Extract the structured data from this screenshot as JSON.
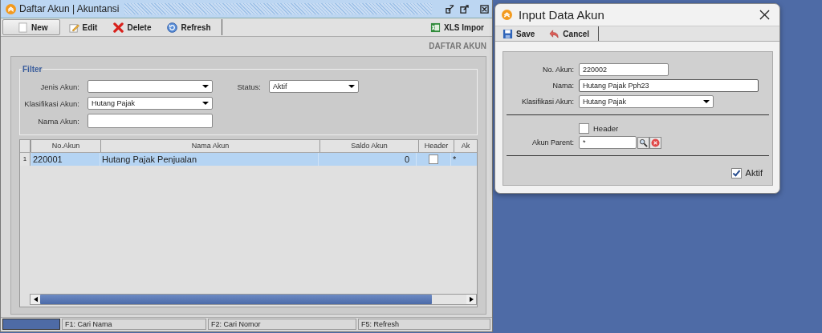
{
  "window": {
    "title": "Daftar Akun | Akuntansi"
  },
  "toolbar": [
    {
      "label": "New",
      "kind": "new"
    },
    {
      "label": "Edit",
      "kind": "edit"
    },
    {
      "label": "Delete",
      "kind": "delete"
    },
    {
      "label": "Refresh",
      "kind": "refresh"
    }
  ],
  "xls_button": {
    "label": "XLS Impor"
  },
  "page_heading": "DAFTAR AKUN",
  "filter": {
    "title": "Filter",
    "jenis_akun": {
      "label": "Jenis Akun:"
    },
    "status": {
      "label": "Status:",
      "value": "Aktif"
    },
    "klasifikasi_akun": {
      "label": "Klasifikasi Akun:",
      "value": "Hutang Pajak"
    },
    "nama_akun": {
      "label": "Nama Akun:"
    }
  },
  "table": {
    "columns": [
      "No.Akun",
      "Nama Akun",
      "Saldo Akun",
      "Header",
      "Ak"
    ],
    "rows": [
      {
        "number": "1",
        "no_akun": "220001",
        "nama_akun": "Hutang Pajak Penjualan",
        "saldo_akun": "0",
        "header": false,
        "column_5": "*",
        "selected": true
      }
    ]
  },
  "status_bar": [
    "F1: Cari Nama",
    "F2: Cari Nomor",
    "F5: Refresh"
  ],
  "dialog": {
    "title": "Input Data Akun",
    "toolbar": [
      {
        "label": "Save",
        "kind": "save"
      },
      {
        "label": "Cancel",
        "kind": "cancel"
      }
    ],
    "no_akun": {
      "label": "No. Akun:",
      "value": "220002"
    },
    "nama": {
      "label": "Nama:",
      "value": "Hutang Pajak Pph23"
    },
    "klasifikasi_akun": {
      "label": "Klasifikasi Akun:",
      "value": "Hutang Pajak"
    },
    "header": {
      "label": "Header",
      "checked": false
    },
    "akun_parent": {
      "label": "Akun Parent:",
      "value": "*"
    },
    "aktif": {
      "label": "Aktif",
      "checked": true
    }
  }
}
